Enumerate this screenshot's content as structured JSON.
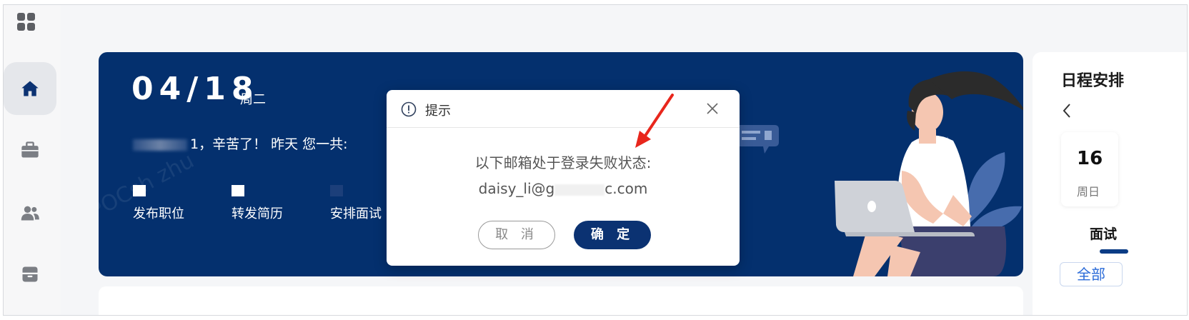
{
  "banner": {
    "date": "04/18",
    "weekday": "周二",
    "greeting_suffix": "1，辛苦了！ 昨天 您一共:",
    "stats": [
      {
        "label": "发布职位"
      },
      {
        "label": "转发简历"
      },
      {
        "label": "安排面试"
      }
    ],
    "watermark": "POCsh zhu"
  },
  "dialog": {
    "title": "提示",
    "message": "以下邮箱处于登录失败状态:",
    "email_prefix": "daisy_li@g",
    "email_suffix": "c.com",
    "cancel_label": "取 消",
    "ok_label": "确 定"
  },
  "right_panel": {
    "title": "日程安排",
    "back_icon": "chevron-left-icon",
    "day_number": "16",
    "day_name": "周日",
    "interview_label": "面试",
    "all_label": "全部"
  },
  "sidebar": {
    "items": [
      {
        "icon": "home-icon",
        "active": true
      },
      {
        "icon": "briefcase-icon",
        "active": false
      },
      {
        "icon": "users-icon",
        "active": false
      },
      {
        "icon": "archive-icon",
        "active": false
      }
    ]
  },
  "colors": {
    "banner_bg": "#04306e",
    "primary_button": "#0b3272",
    "annotation_arrow": "#e8261c"
  }
}
